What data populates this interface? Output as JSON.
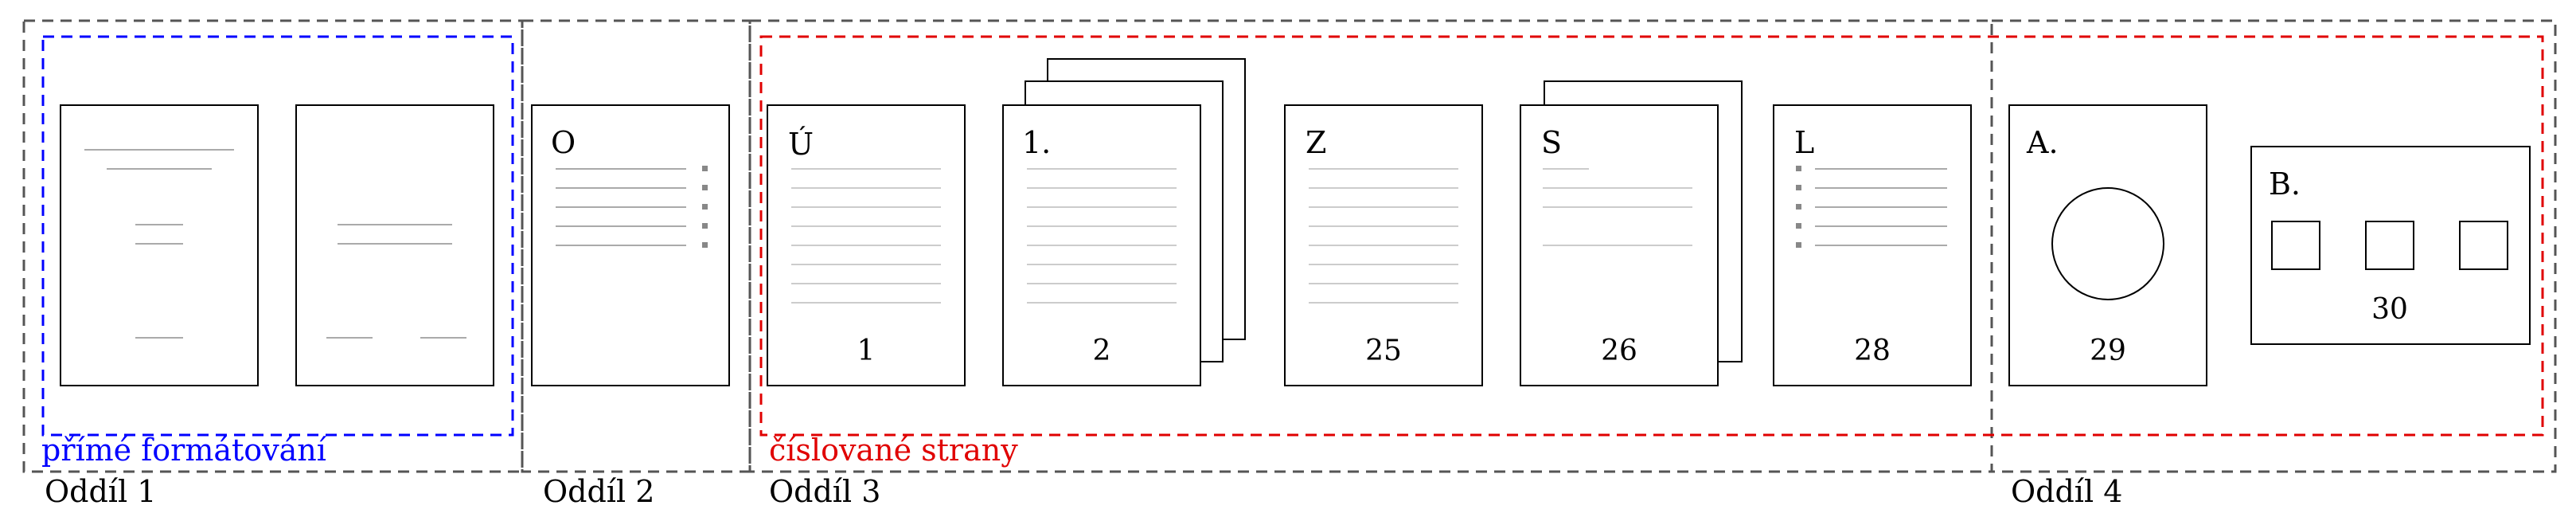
{
  "sections": [
    {
      "label": "Oddíl 1"
    },
    {
      "label": "Oddíl 2"
    },
    {
      "label": "Oddíl 3"
    },
    {
      "label": "Oddíl 4"
    }
  ],
  "regions": {
    "direct_formatting": {
      "label": "přímé formátování",
      "color": "#0000ff"
    },
    "numbered_pages": {
      "label": "číslované strany",
      "color": "#e00000"
    }
  },
  "pages": [
    {
      "letter": "",
      "number": ""
    },
    {
      "letter": "",
      "number": ""
    },
    {
      "letter": "O",
      "number": ""
    },
    {
      "letter": "Ú",
      "number": "1"
    },
    {
      "letter": "1.",
      "number": "2"
    },
    {
      "letter": "Z",
      "number": "25"
    },
    {
      "letter": "S",
      "number": "26"
    },
    {
      "letter": "L",
      "number": "28"
    },
    {
      "letter": "A.",
      "number": "29"
    },
    {
      "letter": "B.",
      "number": "30"
    }
  ],
  "colors": {
    "section_border": "#555555",
    "page_border": "#000000",
    "text_line": "#aaaaaa",
    "dot": "#888888"
  }
}
